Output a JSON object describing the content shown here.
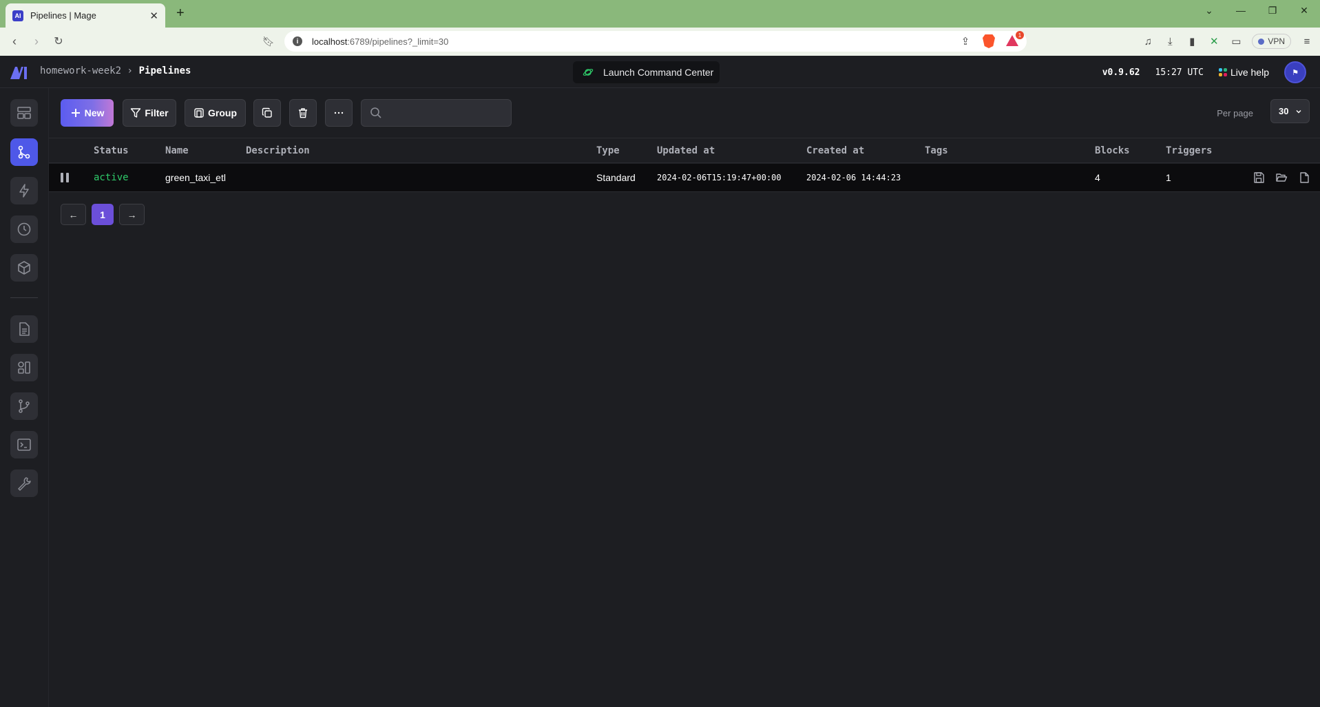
{
  "browser": {
    "tab_title": "Pipelines | Mage",
    "tab_favicon_text": "AI",
    "new_tab": "+",
    "url_host": "localhost",
    "url_rest": ":6789/pipelines?_limit=30",
    "rewards_badge": "1",
    "vpn_label": "VPN"
  },
  "header": {
    "project": "homework-week2",
    "page": "Pipelines",
    "command_center": "Launch Command Center",
    "version": "v0.9.62",
    "time": "15:27 UTC",
    "live_help": "Live help"
  },
  "sidebar": {
    "items": [
      "overview-icon",
      "pipelines-icon",
      "triggers-icon",
      "pipeline-runs-icon",
      "global-data-products-icon",
      "files-icon",
      "templates-icon",
      "version-control-icon",
      "terminal-icon",
      "settings-icon"
    ],
    "active": "pipelines-icon"
  },
  "toolbar": {
    "new_label": "New",
    "filter_label": "Filter",
    "group_label": "Group",
    "search_placeholder": "",
    "per_page_label": "Per page",
    "per_page_value": "30"
  },
  "table": {
    "columns": [
      "Status",
      "Name",
      "Description",
      "Type",
      "Updated at",
      "Created at",
      "Tags",
      "Blocks",
      "Triggers"
    ],
    "rows": [
      {
        "status": "active",
        "name": "green_taxi_etl",
        "description": "",
        "type": "Standard",
        "updated_at": "2024-02-06T15:19:47+00:00",
        "created_at": "2024-02-06 14:44:23",
        "tags": "",
        "blocks": "4",
        "triggers": "1"
      }
    ]
  },
  "pagination": {
    "prev": "←",
    "current_page": "1",
    "next": "→"
  },
  "colors": {
    "accent": "#4e58e8",
    "status_active": "#2fcb6a",
    "page_current": "#6b4fd9",
    "tabbar": "#8ab87b"
  }
}
